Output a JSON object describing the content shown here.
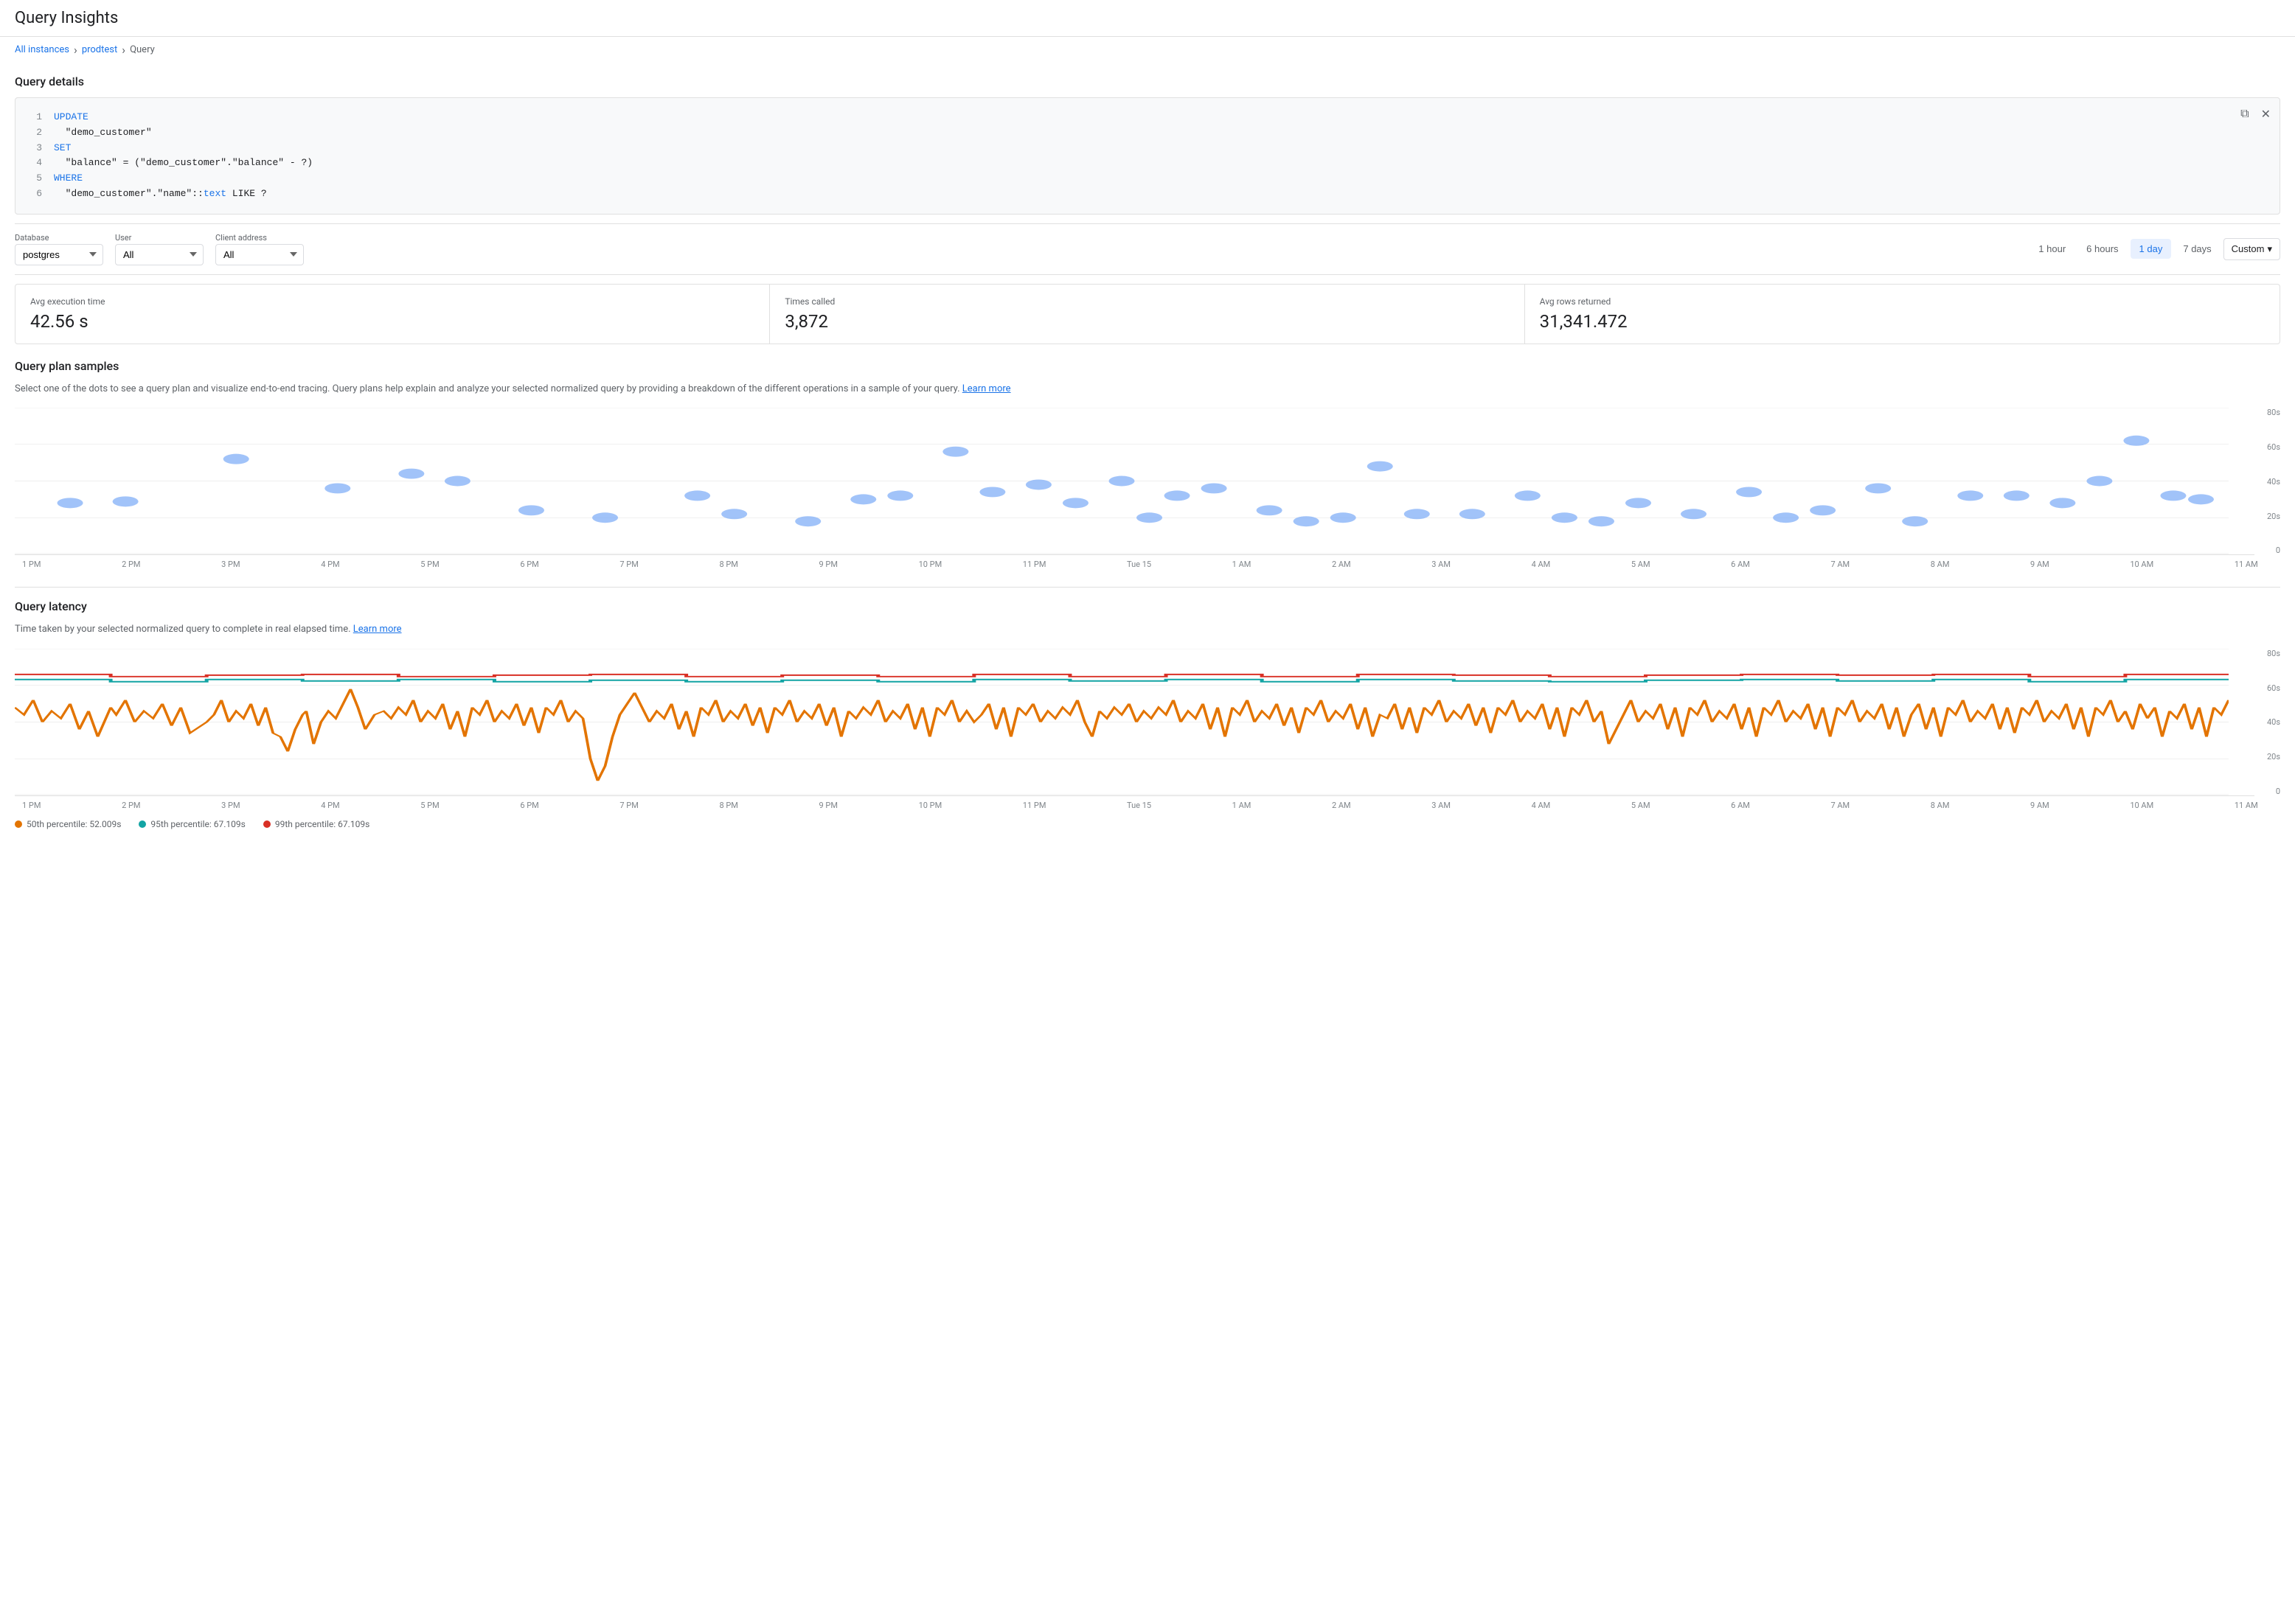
{
  "app": {
    "title": "Query Insights"
  },
  "breadcrumb": {
    "all_instances": "All instances",
    "prodtest": "prodtest",
    "query": "Query"
  },
  "query_details": {
    "section_title": "Query details",
    "code_lines": [
      {
        "num": 1,
        "text": "UPDATE",
        "type": "keyword"
      },
      {
        "num": 2,
        "text": "  \"demo_customer\"",
        "type": "string"
      },
      {
        "num": 3,
        "text": "SET",
        "type": "keyword"
      },
      {
        "num": 4,
        "text": "  \"balance\" = (\"demo_customer\".\"balance\" - ?)",
        "type": "mixed"
      },
      {
        "num": 5,
        "text": "WHERE",
        "type": "keyword"
      },
      {
        "num": 6,
        "text": "  \"demo_customer\".\"name\"::text LIKE ?",
        "type": "mixed"
      }
    ]
  },
  "filters": {
    "database": {
      "label": "Database",
      "value": "postgres",
      "options": [
        "postgres"
      ]
    },
    "user": {
      "label": "User",
      "value": "All",
      "options": [
        "All"
      ]
    },
    "client_address": {
      "label": "Client address",
      "value": "All",
      "options": [
        "All"
      ]
    }
  },
  "time_range": {
    "buttons": [
      "1 hour",
      "6 hours",
      "1 day",
      "7 days"
    ],
    "active": "1 day",
    "custom_label": "Custom"
  },
  "stats": [
    {
      "label": "Avg execution time",
      "value": "42.56 s"
    },
    {
      "label": "Times called",
      "value": "3,872"
    },
    {
      "label": "Avg rows returned",
      "value": "31,341.472"
    }
  ],
  "query_plan_samples": {
    "section_title": "Query plan samples",
    "description": "Select one of the dots to see a query plan and visualize end-to-end tracing. Query plans help explain and analyze your selected normalized query by providing a breakdown of the different operations in a sample of your query.",
    "learn_more": "Learn more",
    "y_labels": [
      "80s",
      "60s",
      "40s",
      "20s",
      "0"
    ],
    "x_labels": [
      "1 PM",
      "2 PM",
      "3 PM",
      "4 PM",
      "5 PM",
      "6 PM",
      "7 PM",
      "8 PM",
      "9 PM",
      "10 PM",
      "11 PM",
      "Tue 15",
      "1 AM",
      "2 AM",
      "3 AM",
      "4 AM",
      "5 AM",
      "6 AM",
      "7 AM",
      "8 AM",
      "9 AM",
      "10 AM",
      "11 AM"
    ]
  },
  "query_latency": {
    "section_title": "Query latency",
    "description": "Time taken by your selected normalized query to complete in real elapsed time.",
    "learn_more": "Learn more",
    "y_labels": [
      "80s",
      "60s",
      "40s",
      "20s",
      "0"
    ],
    "x_labels": [
      "1 PM",
      "2 PM",
      "3 PM",
      "4 PM",
      "5 PM",
      "6 PM",
      "7 PM",
      "8 PM",
      "9 PM",
      "10 PM",
      "11 PM",
      "Tue 15",
      "1 AM",
      "2 AM",
      "3 AM",
      "4 AM",
      "5 AM",
      "6 AM",
      "7 AM",
      "8 AM",
      "9 AM",
      "10 AM",
      "11 AM"
    ],
    "legend": [
      {
        "label": "50th percentile: 52.009s",
        "color": "#e37400",
        "type": "line"
      },
      {
        "label": "95th percentile: 67.109s",
        "color": "#12a4a4",
        "type": "line"
      },
      {
        "label": "99th percentile: 67.109s",
        "color": "#d93025",
        "type": "line"
      }
    ]
  },
  "colors": {
    "accent": "#1a73e8",
    "scatter_dot": "#8ab4f8",
    "line_50": "#e37400",
    "line_95": "#12a4a4",
    "line_99": "#d93025"
  }
}
